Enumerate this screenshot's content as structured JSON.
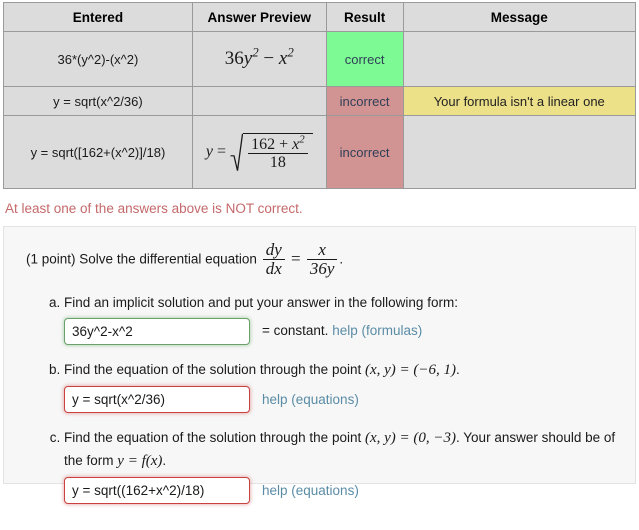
{
  "results_table": {
    "headers": [
      "Entered",
      "Answer Preview",
      "Result",
      "Message"
    ],
    "rows": [
      {
        "entered": "36*(y^2)-(x^2)",
        "preview_text": "36y² − x²",
        "result": "correct",
        "result_state": "correct",
        "message": "",
        "message_state": "none"
      },
      {
        "entered": "y = sqrt(x^2/36)",
        "preview_text": "",
        "result": "incorrect",
        "result_state": "incorrect",
        "message": "Your formula isn't a linear one",
        "message_state": "warn"
      },
      {
        "entered": "y = sqrt([162+(x^2)]/18)",
        "preview_text": "y = √((162 + x²)/18)",
        "result": "incorrect",
        "result_state": "incorrect",
        "message": "",
        "message_state": "none"
      }
    ]
  },
  "preview_math": {
    "row1": {
      "coef": "36",
      "var1": "y",
      "exp1": "2",
      "operator": "−",
      "var2": "x",
      "exp2": "2"
    },
    "row3": {
      "lhs": "y",
      "equals": "=",
      "numerator_a": "162",
      "numerator_op": "+",
      "numerator_var": "x",
      "numerator_exp": "2",
      "denominator": "18"
    }
  },
  "warning": {
    "text": "At least one of the answers above is NOT correct.",
    "color": "#c5696b"
  },
  "problem": {
    "points_label": "(1 point)",
    "prompt_text": "Solve the differential equation",
    "equation": {
      "lhs_num": "dy",
      "lhs_den": "dx",
      "equals": "=",
      "rhs_num": "x",
      "rhs_den": "36y",
      "period": "."
    },
    "parts": [
      {
        "id": "a",
        "text": "Find an implicit solution and put your answer in the following form:",
        "input_value": "36y^2-x^2",
        "input_state": "ok",
        "after_text": "= constant.",
        "help_label": "help (formulas)"
      },
      {
        "id": "b",
        "text_before": "Find the equation of the solution through the point",
        "math_point": "(x, y) = (−6, 1)",
        "text_after": ".",
        "input_value": "y = sqrt(x^2/36)",
        "input_state": "bad",
        "after_text": "",
        "help_label": "help (equations)"
      },
      {
        "id": "c",
        "text_before": "Find the equation of the solution through the point",
        "math_point": "(x, y) = (0, −3)",
        "text_after": ". Your answer should be of the form",
        "math_form": "y = f(x)",
        "text_end": ".",
        "input_value": "y = sqrt((162+x^2)/18)",
        "input_state": "bad",
        "after_text": "",
        "help_label": "help (equations)"
      }
    ]
  },
  "colors": {
    "correct_bg": "#7dfa93",
    "incorrect_bg": "#d29393",
    "warn_bg": "#ece089",
    "table_bg": "#dcdcdc",
    "panel_bg": "#f7f7f7",
    "link": "#5a8ca6"
  }
}
